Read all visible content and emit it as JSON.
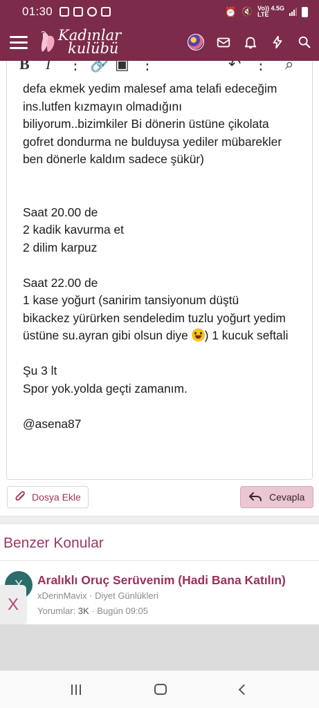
{
  "status_bar": {
    "time": "01:30",
    "network_label_top": "Vo)) 4.5G",
    "network_label_bottom": "LTE"
  },
  "header": {
    "logo_line1": "Kadınlar",
    "logo_line2": "kulübü"
  },
  "post": {
    "lines": [
      "defa ekmek yedim malesef ama telafi edeceğim",
      "ins.lutfen kızmayın olmadığını",
      "biliyorum..bizimkiler Bi dönerin üstüne çikolata",
      "gofret dondurma ne bulduysa yediler mübarekler",
      "ben dönerle kaldım sadece şükür)",
      "",
      "",
      "Saat 20.00 de",
      "2 kadik kavurma et",
      "2 dilim karpuz",
      "",
      "Saat 22.00 de",
      "1 kase yoğurt (sanirim tansiyonum düştü",
      "bikackez yürürken sendeledim tuzlu yoğurt yedim"
    ],
    "line_emoji_before": "üstüne su.ayran gibi olsun diye ",
    "line_emoji_after": ") 1 kucuk seftali",
    "lines_end": [
      "",
      "Şu 3 lt",
      "Spor yok.yolda geçti zamanım.",
      "",
      "@asena87"
    ]
  },
  "actions": {
    "attach_label": "Dosya Ekle",
    "reply_label": "Cevapla"
  },
  "similar": {
    "title": "Benzer Konular",
    "thread": {
      "avatar_letter": "X",
      "title": "Aralıklı Oruç Serüvenim (Hadi Bana Katılın)",
      "author": "xDerinMavix",
      "forum": "Diyet Günlükleri",
      "replies_label": "Yorumlar:",
      "replies_value": "3K",
      "date": "Bugün 09:05"
    }
  },
  "ad": {
    "close_label": "X"
  },
  "colors": {
    "brand": "#7c2b4a",
    "accent": "#9b2f5b",
    "reply_bg": "#ebc7d3"
  }
}
